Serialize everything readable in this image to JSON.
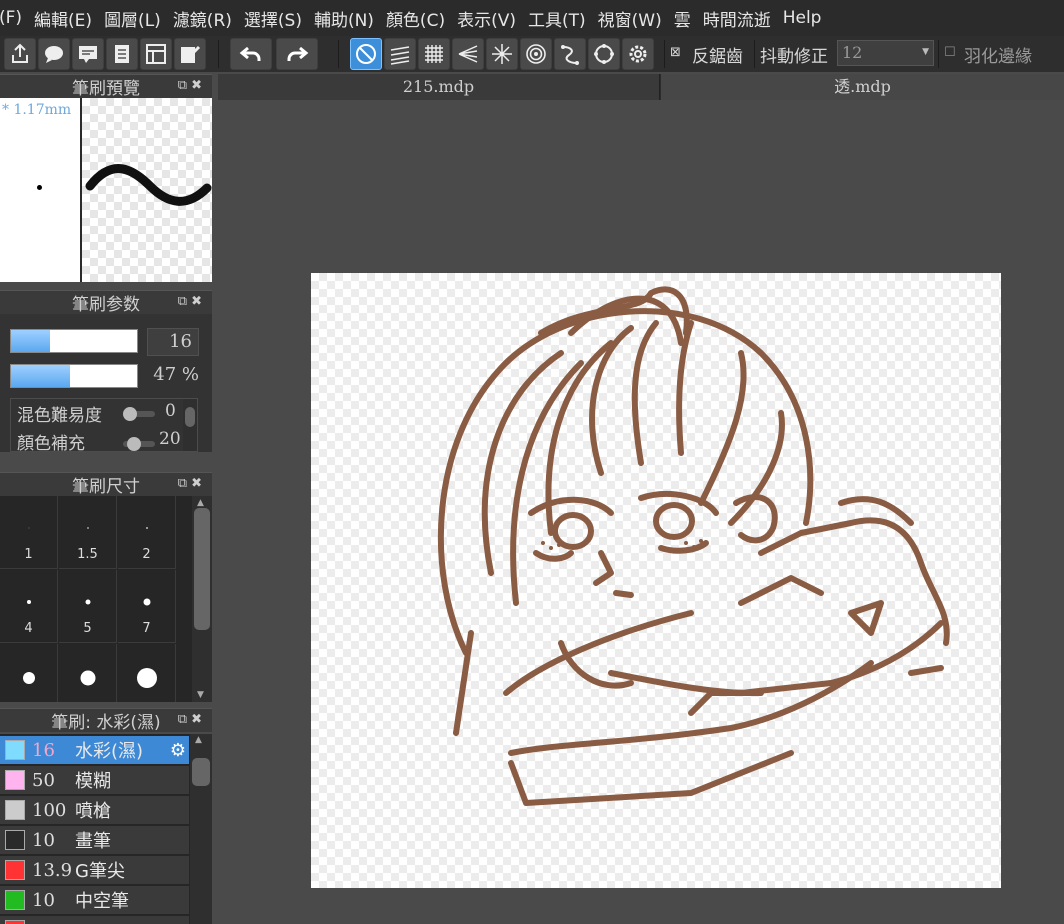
{
  "menu": [
    "(F)",
    "編輯(E)",
    "圖層(L)",
    "濾鏡(R)",
    "選擇(S)",
    "輔助(N)",
    "顏色(C)",
    "表示(V)",
    "工具(T)",
    "視窗(W)",
    "雲",
    "時間流逝",
    "Help"
  ],
  "toolbar": {
    "antialias_label": "反鋸齒",
    "stabilizer_label": "抖動修正",
    "stabilizer_value": "12",
    "feather_label": "羽化邊緣",
    "icons": [
      "export-icon",
      "speech-bubble-icon",
      "comment-icon",
      "document-icon",
      "layout-icon",
      "edit-icon",
      "undo-icon",
      "redo-icon",
      "snap-off-icon",
      "parallel-snap-icon",
      "grid-snap-icon",
      "perspective-snap-icon",
      "radial-snap-icon",
      "concentric-snap-icon",
      "curve-snap-icon",
      "circle-snap-icon",
      "settings-icon"
    ]
  },
  "panels": {
    "preview": {
      "title": "筆刷預覽",
      "size_text": "* 1.17mm"
    },
    "params": {
      "title": "筆刷参数",
      "size_value": "16",
      "opacity_value": "47 %",
      "size_fraction": 0.31,
      "opacity_fraction": 0.47,
      "blend_label": "混色難易度",
      "blend_value": "0",
      "fill_label": "顏色補充",
      "fill_value": "20"
    },
    "sizes": {
      "title": "筆刷尺寸",
      "labels": [
        "1",
        "1.5",
        "2",
        "4",
        "5",
        "7",
        "",
        "",
        ""
      ]
    },
    "brushes": {
      "title": "筆刷: 水彩(濕)",
      "items": [
        {
          "size": "16",
          "name": "水彩(濕)",
          "color": "#7fdcff"
        },
        {
          "size": "50",
          "name": "模糊",
          "color": "#ffb3ef"
        },
        {
          "size": "100",
          "name": "噴槍",
          "color": "#cccccc"
        },
        {
          "size": "10",
          "name": "畫筆",
          "color": "#2a2a2a"
        },
        {
          "size": "13.9",
          "name": "G筆尖",
          "color": "#ff3333"
        },
        {
          "size": "10",
          "name": "中空筆",
          "color": "#22bb22"
        }
      ]
    }
  },
  "tabs": [
    "215.mdp",
    "透.mdp"
  ],
  "colors": {
    "stroke": "#8a5c43",
    "accent": "#3d8fd9"
  }
}
